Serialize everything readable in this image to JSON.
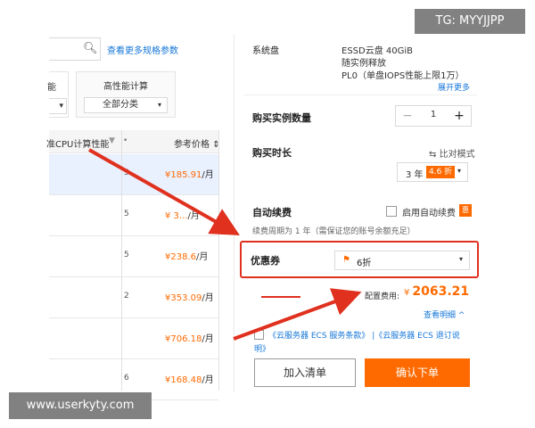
{
  "left_panel": {
    "more_specs_link": "查看更多规格参数",
    "filter_a": {
      "label": "能",
      "value": ""
    },
    "filter_b": {
      "label": "高性能计算",
      "value": "全部分类"
    },
    "table": {
      "col_cpu": "准CPU计算性能",
      "col_price": "参考价格",
      "rows": [
        {
          "mid": "5",
          "price": "¥185.91",
          "unit": "/月",
          "selected": true
        },
        {
          "mid": "5",
          "price": "¥ 3...",
          "unit": "/月",
          "selected": false
        },
        {
          "mid": "5",
          "price": "¥238.6",
          "unit": "/月",
          "selected": false
        },
        {
          "mid": "2",
          "price": "¥353.09",
          "unit": "/月",
          "selected": false
        },
        {
          "mid": "",
          "price": "¥706.18",
          "unit": "/月",
          "selected": false
        },
        {
          "mid": "6",
          "price": "¥168.48",
          "unit": "/月",
          "selected": false
        }
      ]
    }
  },
  "config": {
    "system_disk_label": "系统盘",
    "system_disk_lines": [
      "ESSD云盘 40GiB",
      "随实例释放",
      "PL0（单盘IOPS性能上限1万）"
    ],
    "expand_more": "展开更多",
    "quantity_label": "购买实例数量",
    "quantity_value": "1",
    "duration_label": "购买时长",
    "compare_mode": "比对模式",
    "duration_value": "3 年",
    "discount_badge": "4.6 折",
    "auto_renew_label": "自动续费",
    "auto_renew_checkbox": "启用自动续费",
    "hint_badge": "惠",
    "renew_note": "续费周期为 1 年（需保证您的账号余额充足）",
    "coupon_label": "优惠券",
    "coupon_value": "6折",
    "cost_label": "配置费用:",
    "cost_currency": "¥",
    "cost_value": "2063.21",
    "view_detail": "查看明细 ^",
    "agreement_line1": "《云服务器 ECS 服务条款》 |《云服务器 ECS 退订说",
    "agreement_line2": "明》",
    "add_to_list_button": "加入清单",
    "confirm_order_button": "确认下单"
  },
  "overlays": {
    "tg_tag": "TG: MYYJJPP",
    "site_tag": "www.userkyty.com"
  },
  "colors": {
    "accent_orange": "#ff6a00",
    "highlight_red": "#e0301e",
    "link_blue": "#1677d8"
  }
}
